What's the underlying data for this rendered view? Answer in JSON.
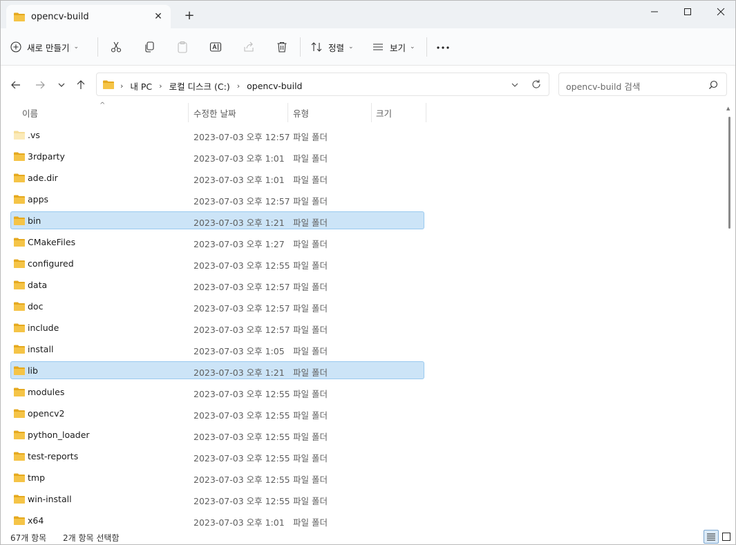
{
  "tab": {
    "title": "opencv-build"
  },
  "toolbar": {
    "new_label": "새로 만들기",
    "sort_label": "정렬",
    "view_label": "보기"
  },
  "address": {
    "crumbs": [
      "내 PC",
      "로컬 디스크 (C:)",
      "opencv-build"
    ]
  },
  "search": {
    "placeholder": "opencv-build 검색"
  },
  "columns": {
    "name": "이름",
    "date": "수정한 날짜",
    "type": "유형",
    "size": "크기"
  },
  "files": [
    {
      "name": ".vs",
      "date": "2023-07-03 오후 12:57",
      "type": "파일 폴더",
      "selected": false,
      "icon": "folder-empty-icon"
    },
    {
      "name": "3rdparty",
      "date": "2023-07-03 오후 1:01",
      "type": "파일 폴더",
      "selected": false,
      "icon": "folder-icon"
    },
    {
      "name": "ade.dir",
      "date": "2023-07-03 오후 1:01",
      "type": "파일 폴더",
      "selected": false,
      "icon": "folder-icon"
    },
    {
      "name": "apps",
      "date": "2023-07-03 오후 12:57",
      "type": "파일 폴더",
      "selected": false,
      "icon": "folder-icon"
    },
    {
      "name": "bin",
      "date": "2023-07-03 오후 1:21",
      "type": "파일 폴더",
      "selected": true,
      "icon": "folder-icon"
    },
    {
      "name": "CMakeFiles",
      "date": "2023-07-03 오후 1:27",
      "type": "파일 폴더",
      "selected": false,
      "icon": "folder-icon"
    },
    {
      "name": "configured",
      "date": "2023-07-03 오후 12:55",
      "type": "파일 폴더",
      "selected": false,
      "icon": "folder-icon"
    },
    {
      "name": "data",
      "date": "2023-07-03 오후 12:57",
      "type": "파일 폴더",
      "selected": false,
      "icon": "folder-icon"
    },
    {
      "name": "doc",
      "date": "2023-07-03 오후 12:57",
      "type": "파일 폴더",
      "selected": false,
      "icon": "folder-icon"
    },
    {
      "name": "include",
      "date": "2023-07-03 오후 12:57",
      "type": "파일 폴더",
      "selected": false,
      "icon": "folder-icon"
    },
    {
      "name": "install",
      "date": "2023-07-03 오후 1:05",
      "type": "파일 폴더",
      "selected": false,
      "icon": "folder-icon"
    },
    {
      "name": "lib",
      "date": "2023-07-03 오후 1:21",
      "type": "파일 폴더",
      "selected": true,
      "icon": "folder-icon"
    },
    {
      "name": "modules",
      "date": "2023-07-03 오후 12:55",
      "type": "파일 폴더",
      "selected": false,
      "icon": "folder-icon"
    },
    {
      "name": "opencv2",
      "date": "2023-07-03 오후 12:55",
      "type": "파일 폴더",
      "selected": false,
      "icon": "folder-icon"
    },
    {
      "name": "python_loader",
      "date": "2023-07-03 오후 12:55",
      "type": "파일 폴더",
      "selected": false,
      "icon": "folder-icon"
    },
    {
      "name": "test-reports",
      "date": "2023-07-03 오후 12:55",
      "type": "파일 폴더",
      "selected": false,
      "icon": "folder-icon"
    },
    {
      "name": "tmp",
      "date": "2023-07-03 오후 12:55",
      "type": "파일 폴더",
      "selected": false,
      "icon": "folder-icon"
    },
    {
      "name": "win-install",
      "date": "2023-07-03 오후 12:55",
      "type": "파일 폴더",
      "selected": false,
      "icon": "folder-icon"
    },
    {
      "name": "x64",
      "date": "2023-07-03 오후 1:01",
      "type": "파일 폴더",
      "selected": false,
      "icon": "folder-icon"
    }
  ],
  "status": {
    "count": "67개 항목",
    "selection": "2개 항목 선택함"
  },
  "colors": {
    "folder": "#f5c447",
    "folder_dark": "#e5a91f",
    "selection_bg": "#cce4f7",
    "selection_border": "#99c9ef",
    "accent": "#0067c0"
  }
}
